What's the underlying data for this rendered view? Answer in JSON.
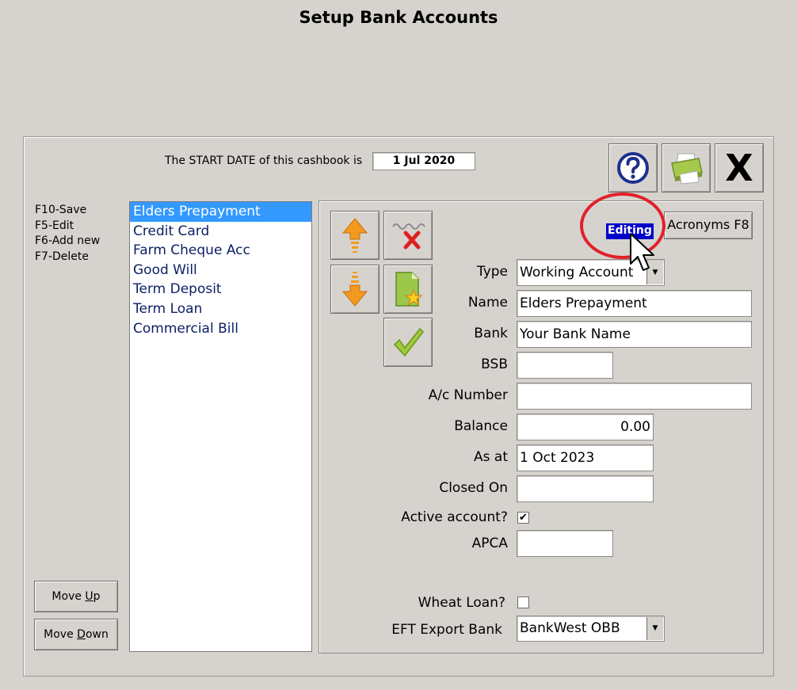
{
  "window": {
    "title": "Setup Bank Accounts"
  },
  "header": {
    "start_date_label": "The START DATE of this cashbook is",
    "start_date_value": "1 Jul 2020"
  },
  "toolbar": {
    "help_icon": "help-icon",
    "print_icon": "printer-icon",
    "close_icon": "close-icon",
    "close_glyph": "X"
  },
  "shortcuts": [
    "F10-Save",
    "F5-Edit",
    "F6-Add new",
    "F7-Delete"
  ],
  "accounts": {
    "items": [
      "Elders Prepayment",
      "Credit Card",
      "Farm Cheque Acc",
      "Good Will",
      "Term Deposit",
      "Term Loan",
      "Commercial Bill"
    ],
    "selected_index": 0
  },
  "list_buttons": {
    "move_up_label": "Move Up",
    "move_up_accel": "U",
    "move_down_label": "Move Down",
    "move_down_accel": "D"
  },
  "status": {
    "editing_label": "Editing"
  },
  "acronyms_button": {
    "label": "Acronyms F8"
  },
  "form": {
    "type_label": "Type",
    "type_value": "Working Account",
    "name_label": "Name",
    "name_value": "Elders Prepayment",
    "bank_label": "Bank",
    "bank_value": "Your Bank Name",
    "bsb_label": "BSB",
    "bsb_value": "",
    "acc_number_label": "A/c Number",
    "acc_number_value": "",
    "balance_label": "Balance",
    "balance_value": "0.00",
    "as_at_label": "As at",
    "as_at_value": "1 Oct 2023",
    "closed_on_label": "Closed On",
    "closed_on_value": "",
    "active_label": "Active account?",
    "active_checked": true,
    "apca_label": "APCA",
    "apca_value": "",
    "wheat_loan_label": "Wheat Loan?",
    "wheat_loan_checked": false,
    "eft_bank_label": "EFT Export Bank",
    "eft_bank_value": "BankWest OBB"
  },
  "colors": {
    "selection": "#3399ff",
    "editing_badge": "#0000cc",
    "highlight_circle": "#e2202a",
    "arrow_orange": "#f39a1e",
    "check_green": "#9fc93a"
  }
}
